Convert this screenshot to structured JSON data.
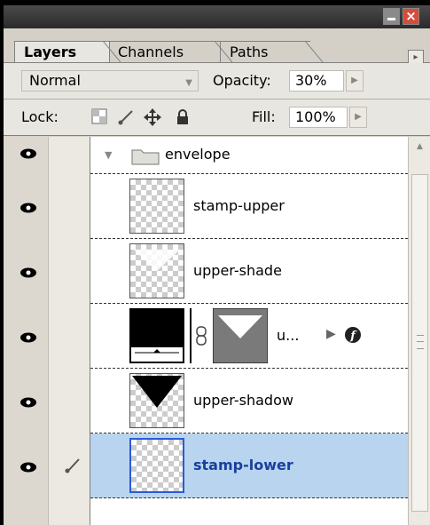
{
  "window": {
    "close_glyph": "×"
  },
  "tabs": [
    {
      "label": "Layers",
      "active": true
    },
    {
      "label": "Channels",
      "active": false
    },
    {
      "label": "Paths",
      "active": false
    }
  ],
  "options": {
    "blend_mode": "Normal",
    "opacity_label": "Opacity:",
    "opacity_value": "30%",
    "lock_label": "Lock:",
    "fill_label": "Fill:",
    "fill_value": "100%"
  },
  "layers": [
    {
      "name": "envelope",
      "type": "group",
      "expanded": true,
      "visible": true
    },
    {
      "name": "stamp-upper",
      "type": "layer",
      "visible": true
    },
    {
      "name": "upper-shade",
      "type": "layer",
      "visible": true
    },
    {
      "name": "u...",
      "type": "adjustment-with-mask",
      "visible": true,
      "has_effects": true
    },
    {
      "name": "upper-shadow",
      "type": "layer",
      "visible": true
    },
    {
      "name": "stamp-lower",
      "type": "layer",
      "visible": true,
      "selected": true
    }
  ],
  "colors": {
    "selected_row": "#b8d4ee",
    "selected_text": "#1a3f9e",
    "close_button": "#d64c3a"
  }
}
